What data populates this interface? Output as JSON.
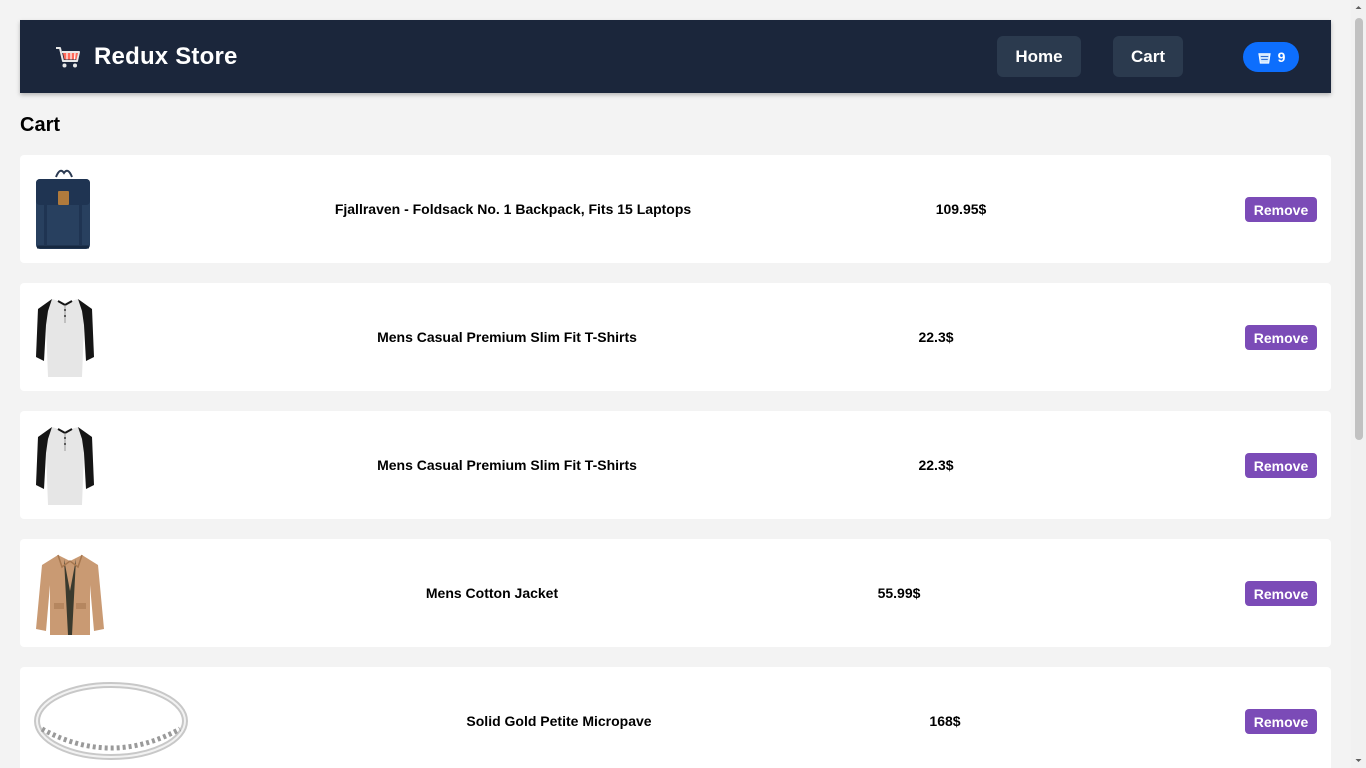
{
  "header": {
    "brand_title": "Redux Store",
    "nav": {
      "home_label": "Home",
      "cart_label": "Cart"
    },
    "cart_count": "9"
  },
  "main": {
    "title": "Cart",
    "items": [
      {
        "name": "Fjallraven - Foldsack No. 1 Backpack, Fits 15 Laptops",
        "price": "109.95$",
        "image": "backpack-image",
        "remove_label": "Remove"
      },
      {
        "name": "Mens Casual Premium Slim Fit T-Shirts",
        "price": "22.3$",
        "image": "tshirt-image",
        "remove_label": "Remove"
      },
      {
        "name": "Mens Casual Premium Slim Fit T-Shirts",
        "price": "22.3$",
        "image": "tshirt-image",
        "remove_label": "Remove"
      },
      {
        "name": "Mens Cotton Jacket",
        "price": "55.99$",
        "image": "jacket-image",
        "remove_label": "Remove"
      },
      {
        "name": "Solid Gold Petite Micropave",
        "price": "168$",
        "image": "ring-image",
        "remove_label": "Remove"
      }
    ]
  },
  "colors": {
    "navbar": "#1b263b",
    "nav_button": "#2b3a4e",
    "badge": "#0d6efd",
    "remove_button": "#7b4bb7",
    "page_background": "#f3f3f3"
  }
}
